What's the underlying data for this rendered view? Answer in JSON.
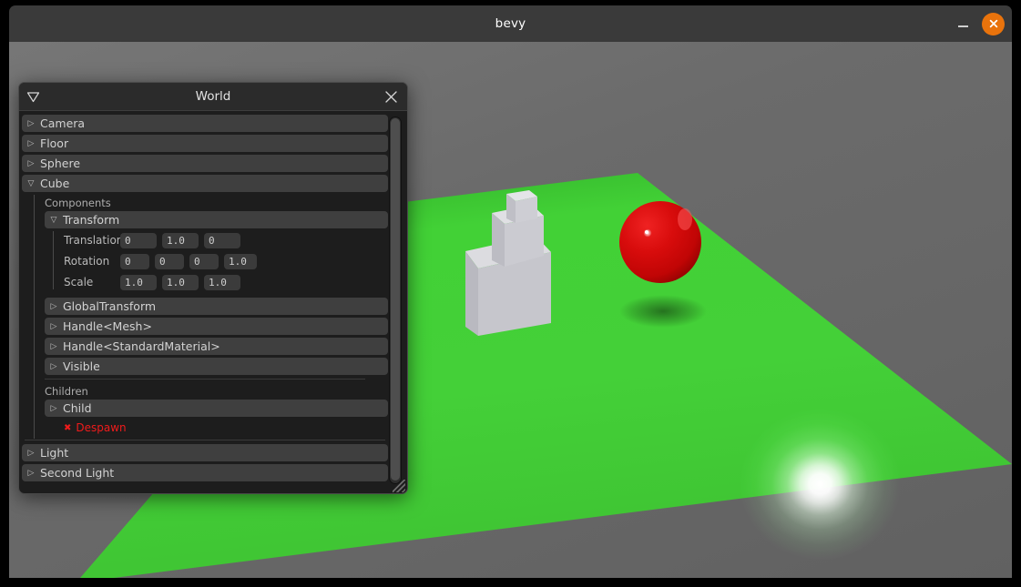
{
  "window": {
    "title": "bevy",
    "minimize_label": "Minimize",
    "close_label": "Close",
    "accent_close": "#e9730c",
    "titlebar_bg": "#3a3a3a"
  },
  "panel": {
    "title": "World",
    "collapse_icon": "triangle-down",
    "close_icon": "close-x",
    "entities": [
      {
        "id": "camera",
        "label": "Camera",
        "expanded": false,
        "marker": "▷"
      },
      {
        "id": "floor",
        "label": "Floor",
        "expanded": false,
        "marker": "▷"
      },
      {
        "id": "sphere",
        "label": "Sphere",
        "expanded": false,
        "marker": "▷"
      },
      {
        "id": "cube",
        "label": "Cube",
        "expanded": true,
        "marker": "▽"
      }
    ],
    "cube": {
      "components_label": "Components",
      "transform": {
        "label": "Transform",
        "marker": "▽",
        "rows": [
          {
            "name": "Translation",
            "values": [
              "0",
              "1.0",
              "0"
            ]
          },
          {
            "name": "Rotation",
            "values": [
              "0",
              "0",
              "0",
              "1.0"
            ]
          },
          {
            "name": "Scale",
            "values": [
              "1.0",
              "1.0",
              "1.0"
            ]
          }
        ]
      },
      "components": [
        {
          "id": "globaltransform",
          "label": "GlobalTransform",
          "marker": "▷"
        },
        {
          "id": "handle-mesh",
          "label": "Handle<Mesh>",
          "marker": "▷"
        },
        {
          "id": "handle-standardmaterial",
          "label": "Handle<StandardMaterial>",
          "marker": "▷"
        },
        {
          "id": "visible",
          "label": "Visible",
          "marker": "▷"
        }
      ],
      "children_label": "Children",
      "children": [
        {
          "id": "child",
          "label": "Child",
          "marker": "▷"
        }
      ],
      "despawn_label": "Despawn",
      "despawn_icon": "✖",
      "despawn_color": "#ef1b1b"
    },
    "entities_after": [
      {
        "id": "light",
        "label": "Light",
        "expanded": false,
        "marker": "▷"
      },
      {
        "id": "second-light",
        "label": "Second Light",
        "expanded": false,
        "marker": "▷"
      }
    ]
  },
  "scene": {
    "background_color": "#6b6b6b",
    "floor_color": "#3dcc33",
    "sphere_color": "#d40a0a",
    "cube_color": "#c9c9cf",
    "light_glow_color": "#ffffff",
    "objects": [
      {
        "name": "floor-plane",
        "kind": "plane"
      },
      {
        "name": "cube-large",
        "kind": "box"
      },
      {
        "name": "cube-medium",
        "kind": "box"
      },
      {
        "name": "cube-small",
        "kind": "box"
      },
      {
        "name": "sphere-red",
        "kind": "sphere"
      },
      {
        "name": "light-hotspot",
        "kind": "light"
      }
    ]
  }
}
